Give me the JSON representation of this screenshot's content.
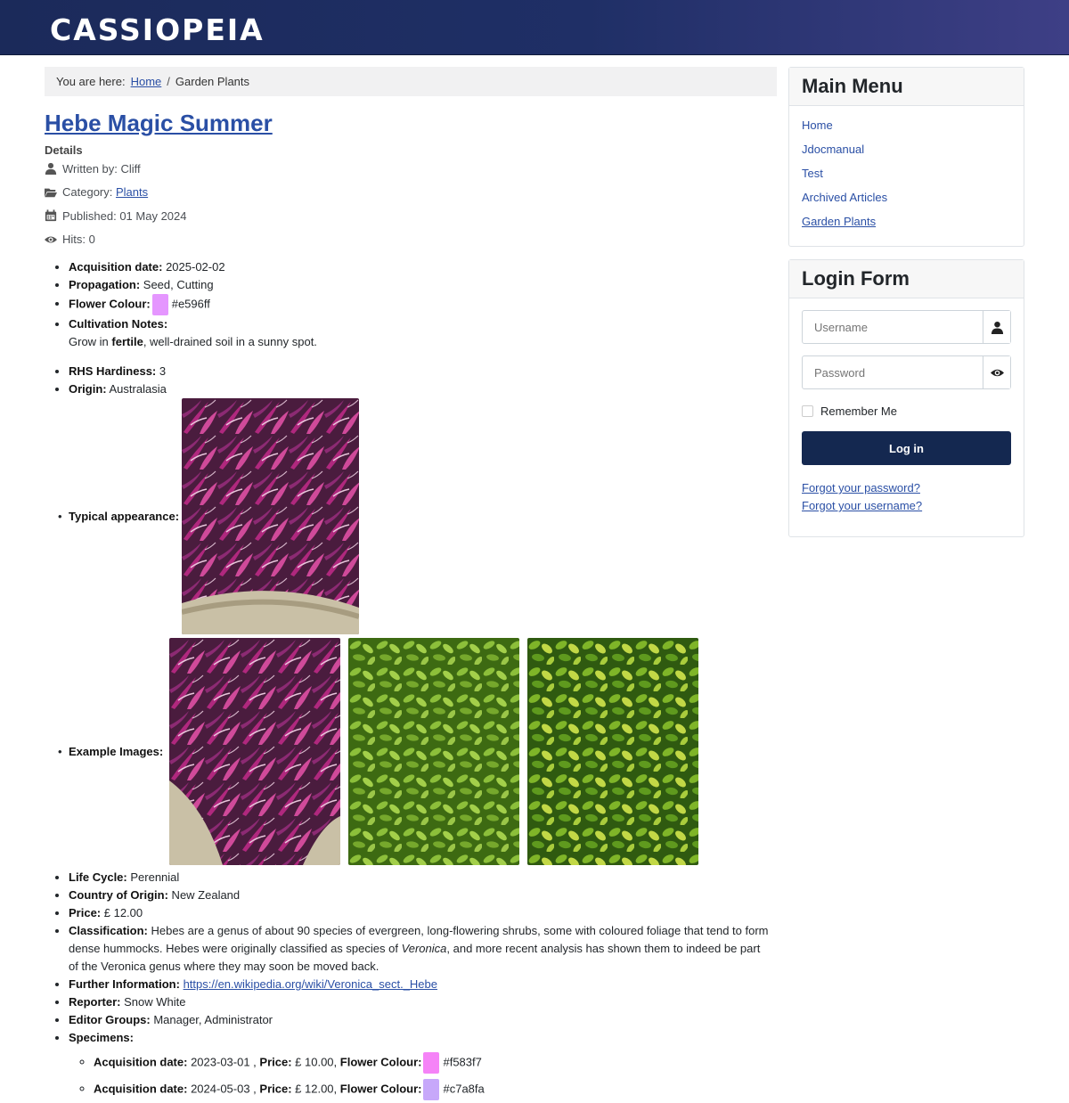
{
  "header": {
    "brand": "CASSIOPEIA"
  },
  "breadcrumb": {
    "prefix": "You are here:",
    "home": "Home",
    "separator": "/",
    "current": "Garden Plants"
  },
  "article": {
    "title": "Hebe Magic Summer",
    "details_heading": "Details",
    "written_by": "Written by: Cliff",
    "category_label": "Category: ",
    "category_link": "Plants",
    "published": "Published: 01 May 2024",
    "hits": "Hits: 0"
  },
  "fields": {
    "acquisition_label": "Acquisition date:",
    "acquisition_value": " 2025-02-02",
    "propagation_label": "Propagation:",
    "propagation_value": " Seed, Cutting",
    "flower_label": "Flower Colour:",
    "flower_value": "#e596ff",
    "flower_color": "#e596ff",
    "cultivation_label": "Cultivation Notes:",
    "cultivation_pre": "Grow in ",
    "cultivation_bold": "fertile",
    "cultivation_post": ", well-drained soil in a sunny spot.",
    "rhs_label": "RHS Hardiness:",
    "rhs_value": " 3",
    "origin_label": "Origin:",
    "origin_value": " Australasia",
    "typical_label": "Typical appearance:",
    "examples_label": "Example Images:",
    "lifecycle_label": "Life Cycle:",
    "lifecycle_value": " Perennial",
    "country_label": "Country of Origin:",
    "country_value": " New Zealand",
    "price_label": "Price:",
    "price_value": " £ 12.00",
    "class_label": "Classification:",
    "class_pre": " Hebes are a genus of about 90 species of evergreen, long-flowering shrubs, some with coloured foliage that tend to form dense hummocks. Hebes were originally classified as species of ",
    "class_italic": "Veronica",
    "class_post": ", and more recent analysis has shown them to indeed be part of the Veronica genus where they may soon be moved back.",
    "further_label": "Further Information:",
    "further_link": "https://en.wikipedia.org/wiki/Veronica_sect._Hebe",
    "reporter_label": "Reporter:",
    "reporter_value": " Snow White",
    "editor_label": "Editor Groups:",
    "editor_value": " Manager, Administrator",
    "specimens_label": "Specimens:"
  },
  "specimens": [
    {
      "acq_label": "Acquisition date:",
      "acq_value": " 2023-03-01 , ",
      "price_label": "Price:",
      "price_value": " £ 10.00, ",
      "colour_label": "Flower Colour:",
      "colour_value": "#f583f7",
      "color": "#f583f7"
    },
    {
      "acq_label": "Acquisition date:",
      "acq_value": " 2024-05-03 , ",
      "price_label": "Price:",
      "price_value": " £ 12.00, ",
      "colour_label": "Flower Colour:",
      "colour_value": "#c7a8fa",
      "color": "#c7a8fa"
    }
  ],
  "main_menu": {
    "title": "Main Menu",
    "items": [
      "Home",
      "Jdocmanual",
      "Test",
      "Archived Articles",
      "Garden Plants"
    ]
  },
  "login": {
    "title": "Login Form",
    "username_placeholder": "Username",
    "password_placeholder": "Password",
    "remember": "Remember Me",
    "button": "Log in",
    "forgot_password": "Forgot your password?",
    "forgot_username": "Forgot your username?"
  }
}
